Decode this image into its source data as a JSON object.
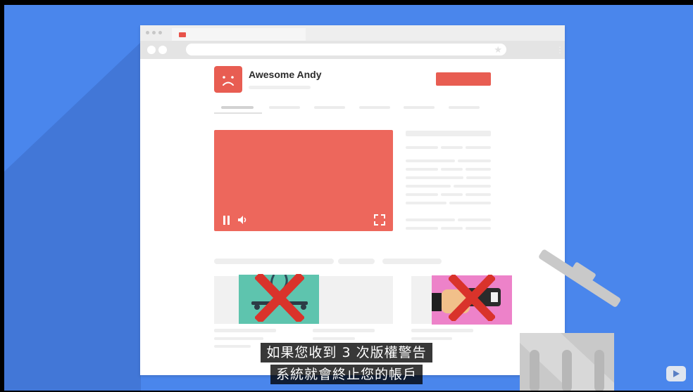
{
  "channel": {
    "name": "Awesome Andy",
    "avatar_icon": "sad-face-icon"
  },
  "player": {
    "pause_icon": "pause-icon",
    "volume_icon": "volume-icon",
    "fullscreen_icon": "fullscreen-icon"
  },
  "thumbnails": [
    {
      "icon": "skateboard-icon",
      "status_icon": "red-x-icon",
      "removed": true
    },
    {
      "icon": "hand-phone-icon",
      "status_icon": "red-x-icon",
      "removed": true
    }
  ],
  "subtitles": {
    "line1": "如果您收到 3 次版權警告",
    "line2": "系統就會終止您的帳戶"
  },
  "colors": {
    "background": "#4a86ec",
    "accent_red": "#e85d52",
    "player_red": "#ed675c",
    "x_red": "#d9332b"
  }
}
